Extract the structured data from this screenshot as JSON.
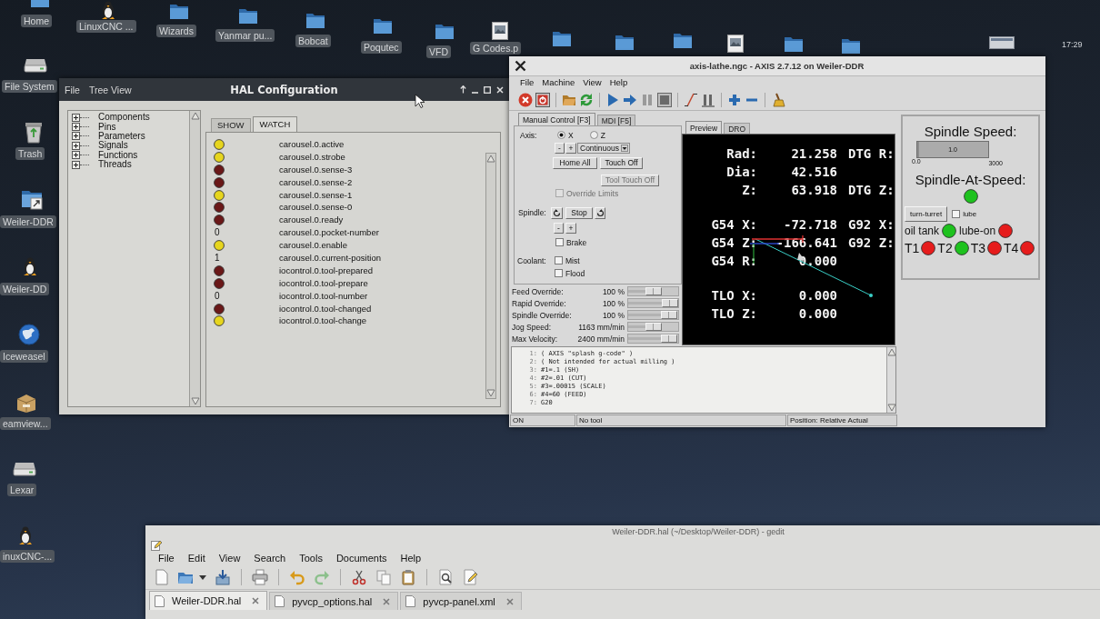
{
  "desktop": {
    "top_icons": [
      {
        "kind": "folder",
        "label": "Home"
      },
      {
        "kind": "penguin",
        "label": "LinuxCNC ..."
      },
      {
        "kind": "folder",
        "label": "Wizards"
      },
      {
        "kind": "folder",
        "label": "Yanmar pu..."
      },
      {
        "kind": "folder",
        "label": "Bobcat"
      },
      {
        "kind": "folder",
        "label": "Poqutec"
      },
      {
        "kind": "folder",
        "label": "VFD"
      },
      {
        "kind": "image",
        "label": "G Codes.p"
      }
    ],
    "left_icons": [
      {
        "kind": "drive",
        "label": "File System"
      },
      {
        "kind": "trash",
        "label": "Trash"
      },
      {
        "kind": "shortcut",
        "label": "Weiler-DDR"
      },
      {
        "kind": "penguin",
        "label": "Weiler-DD"
      },
      {
        "kind": "globe",
        "label": "Iceweasel"
      },
      {
        "kind": "package",
        "label": "eamview..."
      },
      {
        "kind": "drive",
        "label": "Lexar"
      },
      {
        "kind": "penguin",
        "label": "inuxCNC-..."
      }
    ],
    "clock": "17:29"
  },
  "hal_window": {
    "title": "HAL Configuration",
    "menu": [
      "File",
      "Tree View"
    ],
    "tree": [
      {
        "label": "Components",
        "expanded": false
      },
      {
        "label": "Pins",
        "expanded": false
      },
      {
        "label": "Parameters",
        "expanded": false
      },
      {
        "label": "Signals",
        "expanded": false
      },
      {
        "label": "Functions",
        "expanded": false
      },
      {
        "label": "Threads",
        "expanded": false
      }
    ],
    "tabs": [
      {
        "label": "SHOW",
        "selected": false
      },
      {
        "label": "WATCH",
        "selected": true
      }
    ],
    "watch": [
      {
        "kind": "bit",
        "on": true,
        "name": "carousel.0.active"
      },
      {
        "kind": "bit",
        "on": true,
        "name": "carousel.0.strobe"
      },
      {
        "kind": "bit",
        "on": false,
        "name": "carousel.0.sense-3"
      },
      {
        "kind": "bit",
        "on": false,
        "name": "carousel.0.sense-2"
      },
      {
        "kind": "bit",
        "on": true,
        "name": "carousel.0.sense-1"
      },
      {
        "kind": "bit",
        "on": false,
        "name": "carousel.0.sense-0"
      },
      {
        "kind": "bit",
        "on": false,
        "name": "carousel.0.ready"
      },
      {
        "kind": "value",
        "value": "0",
        "name": "carousel.0.pocket-number"
      },
      {
        "kind": "bit",
        "on": true,
        "name": "carousel.0.enable"
      },
      {
        "kind": "value",
        "value": "1",
        "name": "carousel.0.current-position"
      },
      {
        "kind": "bit",
        "on": false,
        "name": "iocontrol.0.tool-prepared"
      },
      {
        "kind": "bit",
        "on": false,
        "name": "iocontrol.0.tool-prepare"
      },
      {
        "kind": "value",
        "value": "0",
        "name": "iocontrol.0.tool-number"
      },
      {
        "kind": "bit",
        "on": false,
        "name": "iocontrol.0.tool-changed"
      },
      {
        "kind": "bit",
        "on": true,
        "name": "iocontrol.0.tool-change"
      }
    ]
  },
  "axis_window": {
    "title": "axis-lathe.ngc - AXIS 2.7.12 on Weiler-DDR",
    "menu": [
      "File",
      "Machine",
      "View",
      "Help"
    ],
    "control_tabs": [
      {
        "label": "Manual Control [F3]",
        "selected": true
      },
      {
        "label": "MDI [F5]",
        "selected": false
      }
    ],
    "axis_label": "Axis:",
    "axes": [
      {
        "label": "X",
        "selected": true
      },
      {
        "label": "Z",
        "selected": false
      }
    ],
    "jog_minus": "-",
    "jog_plus": "+",
    "jog_mode": "Continuous",
    "home_all": "Home All",
    "touch_off": "Touch Off",
    "tool_touch_off": {
      "label": "Tool Touch Off",
      "disabled": true
    },
    "override_limits": {
      "label": "Override Limits",
      "checked": false,
      "disabled": true
    },
    "spindle_label": "Spindle:",
    "spindle_stop": "Stop",
    "spindle_minus": "-",
    "spindle_plus": "+",
    "brake": {
      "label": "Brake",
      "checked": false
    },
    "coolant_label": "Coolant:",
    "coolant": [
      {
        "label": "Mist",
        "checked": false
      },
      {
        "label": "Flood",
        "checked": false
      }
    ],
    "sliders": [
      {
        "label": "Feed Override:",
        "reading": "100 %",
        "level": 0.51
      },
      {
        "label": "Rapid Override:",
        "reading": "100 %",
        "level": 1.0
      },
      {
        "label": "Spindle Override:",
        "reading": "100 %",
        "level": 0.98
      },
      {
        "label": "Jog Speed:",
        "reading": "1163 mm/min",
        "level": 0.51
      },
      {
        "label": "Max Velocity:",
        "reading": "2400 mm/min",
        "level": 0.98
      }
    ],
    "view_tabs": [
      {
        "label": "Preview",
        "selected": true
      },
      {
        "label": "DRO",
        "selected": false
      }
    ],
    "dro": [
      {
        "rows": [
          {
            "label": "Rad:",
            "value": "21.258",
            "extra": "DTG R:"
          },
          {
            "label": "Dia:",
            "value": "42.516"
          },
          {
            "label": "Z:",
            "value": "63.918",
            "extra": "DTG Z:"
          }
        ]
      },
      {
        "rows": [
          {
            "label": "G54 X:",
            "value": "-72.718",
            "extra": "G92 X:"
          },
          {
            "label": "G54 Z:",
            "value": "-166.641",
            "extra": "G92 Z:"
          },
          {
            "label": "G54 R:",
            "value": "0.000"
          }
        ]
      },
      {
        "rows": [
          {
            "label": "TLO X:",
            "value": "0.000"
          },
          {
            "label": "TLO Z:",
            "value": "0.000"
          }
        ]
      }
    ],
    "gcode": [
      {
        "number": "1:",
        "text": "( AXIS \"splash g-code\" )"
      },
      {
        "number": "2:",
        "text": "( Not intended for actual milling )"
      },
      {
        "number": "3:",
        "text": "#1=.1 (SH)"
      },
      {
        "number": "4:",
        "text": "#2=.01 (CUT)"
      },
      {
        "number": "5:",
        "text": "#3=.00015 (SCALE)"
      },
      {
        "number": "6:",
        "text": "#4=60 (FEED)"
      },
      {
        "number": "7:",
        "text": "G20"
      }
    ],
    "status_bar": [
      "ON",
      "No tool",
      "Position: Relative Actual"
    ]
  },
  "pyvcp": {
    "title": "Spindle Speed:",
    "bar": {
      "value": "1.0",
      "level": 0.0003,
      "min": "0.0",
      "max": "3000"
    },
    "at_speed": {
      "label": "Spindle-At-Speed:",
      "on": true
    },
    "turret_button": "turn-turret",
    "lube": {
      "label": "lube",
      "checked": false
    },
    "leds": [
      {
        "label": "oil tank",
        "on": true
      },
      {
        "label": "lube-on",
        "on": false
      }
    ],
    "tools": [
      {
        "label": "T1",
        "on": false
      },
      {
        "label": "T2",
        "on": true
      },
      {
        "label": "T3",
        "on": false
      },
      {
        "label": "T4",
        "on": false
      }
    ]
  },
  "gedit_window": {
    "title": "Weiler-DDR.hal (~/Desktop/Weiler-DDR) - gedit",
    "menu": [
      "File",
      "Edit",
      "View",
      "Search",
      "Tools",
      "Documents",
      "Help"
    ],
    "tabs": [
      {
        "label": "Weiler-DDR.hal",
        "selected": true
      },
      {
        "label": "pyvcp_options.hal",
        "selected": false
      },
      {
        "label": "pyvcp-panel.xml",
        "selected": false
      }
    ]
  }
}
